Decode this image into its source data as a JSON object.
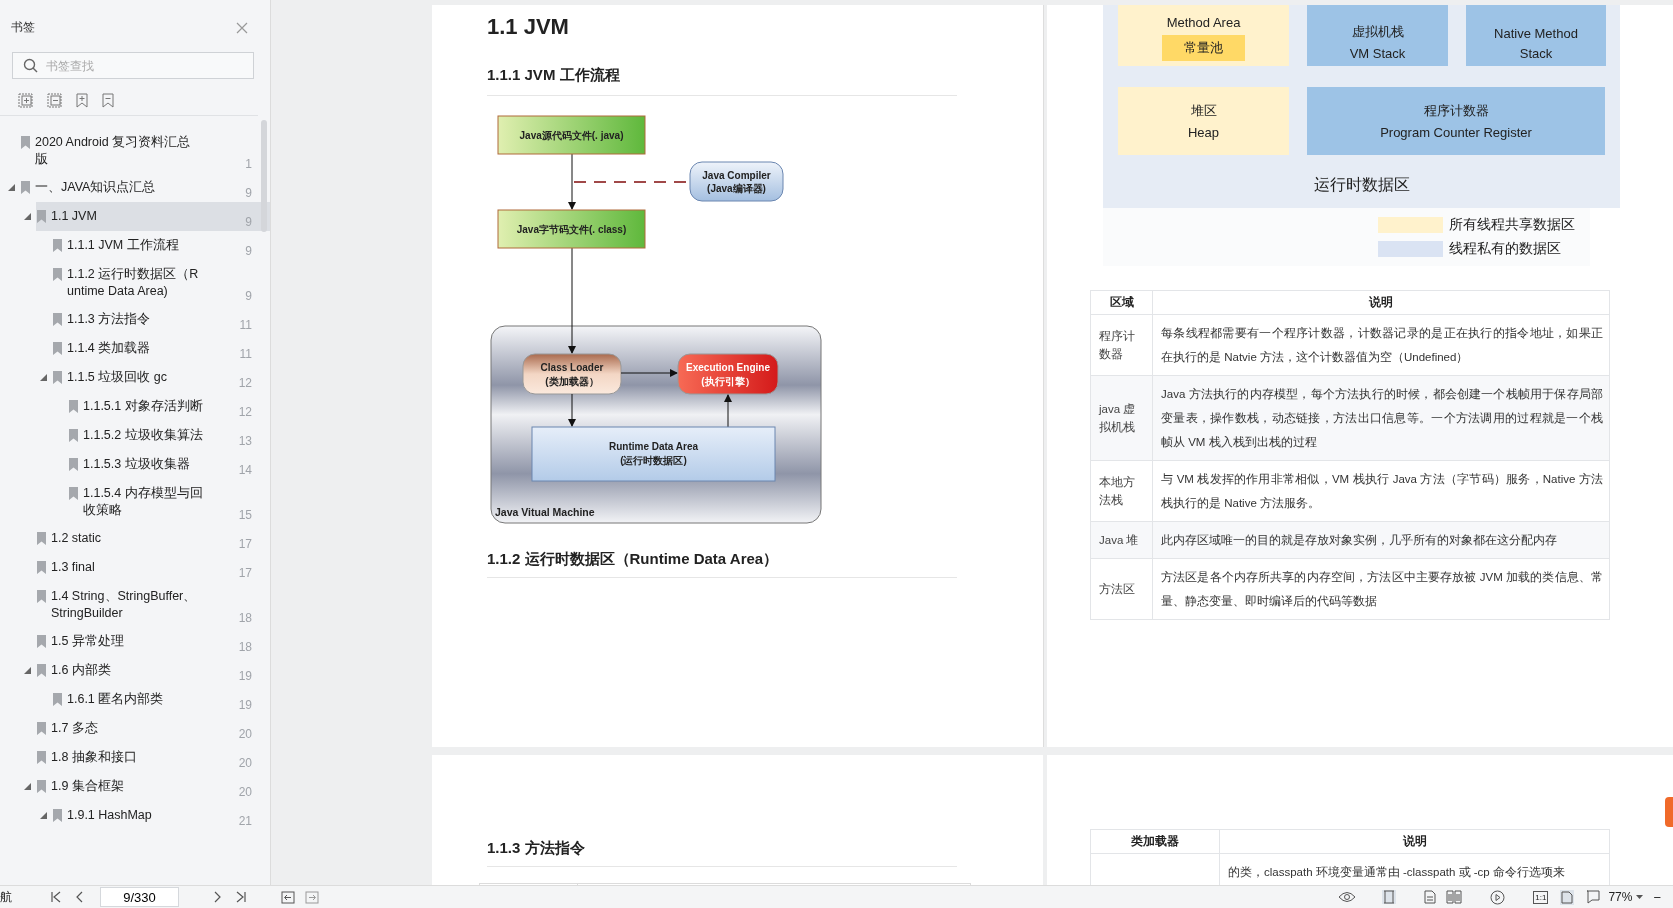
{
  "sidebar": {
    "title": "书签",
    "search": {
      "placeholder": "书签查找"
    },
    "tree": [
      {
        "label": "2020 Android 复习资料汇总版",
        "page": "1",
        "selected": false
      },
      {
        "label": "一、JAVA知识点汇总",
        "page": "9",
        "selected": false,
        "expanded": true,
        "children": [
          {
            "label": "1.1 JVM",
            "page": "9",
            "selected": true,
            "expanded": true,
            "children": [
              {
                "label": "1.1.1 JVM 工作流程",
                "page": "9",
                "selected": false
              },
              {
                "label": "1.1.2 运行时数据区（Runtime Data Area)",
                "page": "9",
                "selected": false
              },
              {
                "label": "1.1.3 方法指令",
                "page": "11",
                "selected": false
              },
              {
                "label": "1.1.4 类加载器",
                "page": "11",
                "selected": false
              },
              {
                "label": "1.1.5 垃圾回收 gc",
                "page": "12",
                "selected": false,
                "expanded": true,
                "children": [
                  {
                    "label": "1.1.5.1 对象存活判断",
                    "page": "12",
                    "selected": false
                  },
                  {
                    "label": "1.1.5.2 垃圾收集算法",
                    "page": "13",
                    "selected": false
                  },
                  {
                    "label": "1.1.5.3 垃圾收集器",
                    "page": "14",
                    "selected": false
                  },
                  {
                    "label": "1.1.5.4 内存模型与回收策略",
                    "page": "15",
                    "selected": false
                  }
                ]
              }
            ]
          },
          {
            "label": "1.2 static",
            "page": "17",
            "selected": false
          },
          {
            "label": "1.3 final",
            "page": "17",
            "selected": false
          },
          {
            "label": "1.4 String、StringBuffer、StringBuilder",
            "page": "18",
            "selected": false
          },
          {
            "label": "1.5 异常处理",
            "page": "18",
            "selected": false
          },
          {
            "label": "1.6 内部类",
            "page": "19",
            "selected": false,
            "expanded": true,
            "children": [
              {
                "label": "1.6.1 匿名内部类",
                "page": "19",
                "selected": false
              }
            ]
          },
          {
            "label": "1.7 多态",
            "page": "20",
            "selected": false
          },
          {
            "label": "1.8 抽象和接口",
            "page": "20",
            "selected": false
          },
          {
            "label": "1.9 集合框架",
            "page": "20",
            "selected": false,
            "expanded": true,
            "children": [
              {
                "label": "1.9.1 HashMap",
                "page": "21",
                "selected": false,
                "expanded": true
              }
            ]
          }
        ]
      }
    ]
  },
  "page_left": {
    "title": "1.1 JVM",
    "section_1": "1.1.1 JVM  工作流程",
    "flow_diagram": {
      "source_file": "Java源代码文件(. java)",
      "compiler": [
        "Java Compiler",
        "(Java编译器)"
      ],
      "bytecode_file": "Java字节码文件(. class)",
      "class_loader": [
        "Class Loader",
        "(类加载器）"
      ],
      "execution_engine": [
        "Execution Engine",
        "(执行引擎）"
      ],
      "runtime_data_area": [
        "Runtime  Data  Area",
        "(运行时数据区)"
      ],
      "jvm_label": "Java Vitual Machine"
    },
    "section_2": "1.1.2  运行时数据区（Runtime Data Area）",
    "section_3": "1.1.3  方法指令"
  },
  "page_right": {
    "memory_diagram": {
      "rows": [
        [
          {
            "kind": "shared",
            "lines": [
              "Method Area"
            ],
            "pool": "常量池"
          },
          {
            "kind": "private",
            "lines": [
              "虚拟机栈",
              "VM Stack"
            ]
          },
          {
            "kind": "private",
            "lines": [
              "Native Method",
              "Stack"
            ]
          }
        ],
        [
          {
            "kind": "shared",
            "lines": [
              "堆区",
              "Heap"
            ]
          },
          {
            "kind": "private",
            "lines": [
              "程序计数器",
              "Program Counter Register"
            ]
          }
        ]
      ],
      "caption": "运行时数据区",
      "legend": [
        {
          "label": "所有线程共享数据区",
          "color": "#fff2cc"
        },
        {
          "label": "线程私有的数据区",
          "color": "#dae3f3"
        }
      ]
    },
    "table": {
      "columns": [
        "区域",
        "说明"
      ],
      "rows": [
        [
          "程序计数器",
          "每条线程都需要有一个程序计数器，计数器记录的是正在执行的指令地址，如果正在执行的是 Natvie  方法，这个计数器值为空（Undefined）"
        ],
        [
          "java 虚拟机栈",
          "Java 方法执行的内存模型，每个方法执行的时候，都会创建一个栈帧用于保存局部变量表，操作数栈，动态链接，方法出口信息等。一个方法调用的过程就是一个栈帧从 VM 栈入栈到出栈的过程"
        ],
        [
          "本地方法栈",
          "与 VM 栈发挥的作用非常相似，VM 栈执行 Java 方法（字节码）服务，Native 方法栈执行的是 Native 方法服务。"
        ],
        [
          "Java 堆",
          "此内存区域唯一的目的就是存放对象实例，几乎所有的对象都在这分配内存"
        ],
        [
          "方法区",
          "方法区是各个内存所共享的内存空间，方法区中主要存放被 JVM 加载的类信息、常量、静态变量、即时编译后的代码等数据"
        ]
      ]
    },
    "table_2": {
      "columns": [
        "类加载器",
        "说明"
      ],
      "rows": [
        [
          "",
          "的类，classpath  环境变量通常由  -classpath  或  -cp  命令行选项来"
        ]
      ]
    }
  },
  "status_bar": {
    "nav_label": "航",
    "page": "9/330",
    "actual_size": "1:1",
    "zoom": "77%",
    "zoom_out": "−"
  }
}
